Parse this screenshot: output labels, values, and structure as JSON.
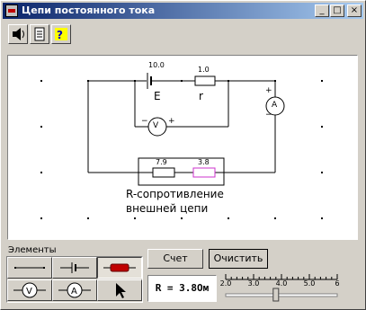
{
  "window": {
    "title": "Цепи постоянного тока"
  },
  "titlebar_buttons": {
    "minimize": "_",
    "maximize": "□",
    "close": "×"
  },
  "toolbar": {
    "tools": [
      "speaker-icon",
      "document-icon",
      "help-icon"
    ],
    "help_glyph": "?"
  },
  "circuit": {
    "battery_value": "10.0",
    "battery_label": "E",
    "internal_resistor_value": "1.0",
    "internal_resistor_label": "r",
    "voltmeter_label": "V",
    "voltmeter_minus": "−",
    "voltmeter_plus": "+",
    "ammeter_label": "A",
    "ammeter_plus": "+",
    "ammeter_minus": "−",
    "external_resistor_1_value": "7.9",
    "external_resistor_2_value": "3.8",
    "caption_line1": "R-сопротивление",
    "caption_line2": "внешней цепи"
  },
  "elements": {
    "label": "Элементы",
    "items": [
      "wire-element",
      "battery-element",
      "resistor-element",
      "voltmeter-element",
      "ammeter-element",
      "pointer-element"
    ],
    "voltmeter_glyph": "V",
    "ammeter_glyph": "A"
  },
  "actions": {
    "count_label": "Счет",
    "clear_label": "Очистить"
  },
  "readout": {
    "text": "R = 3.8Ом"
  },
  "slider": {
    "ticks": [
      "2.0",
      "3.0",
      "4.0",
      "5.0",
      "6"
    ],
    "min": 2.0,
    "max": 6.0,
    "value": 3.8
  },
  "colors": {
    "title_start": "#0a246a",
    "title_end": "#a6caf0",
    "selected_resistor": "#cc33cc",
    "resistor_icon": "#c00000"
  }
}
